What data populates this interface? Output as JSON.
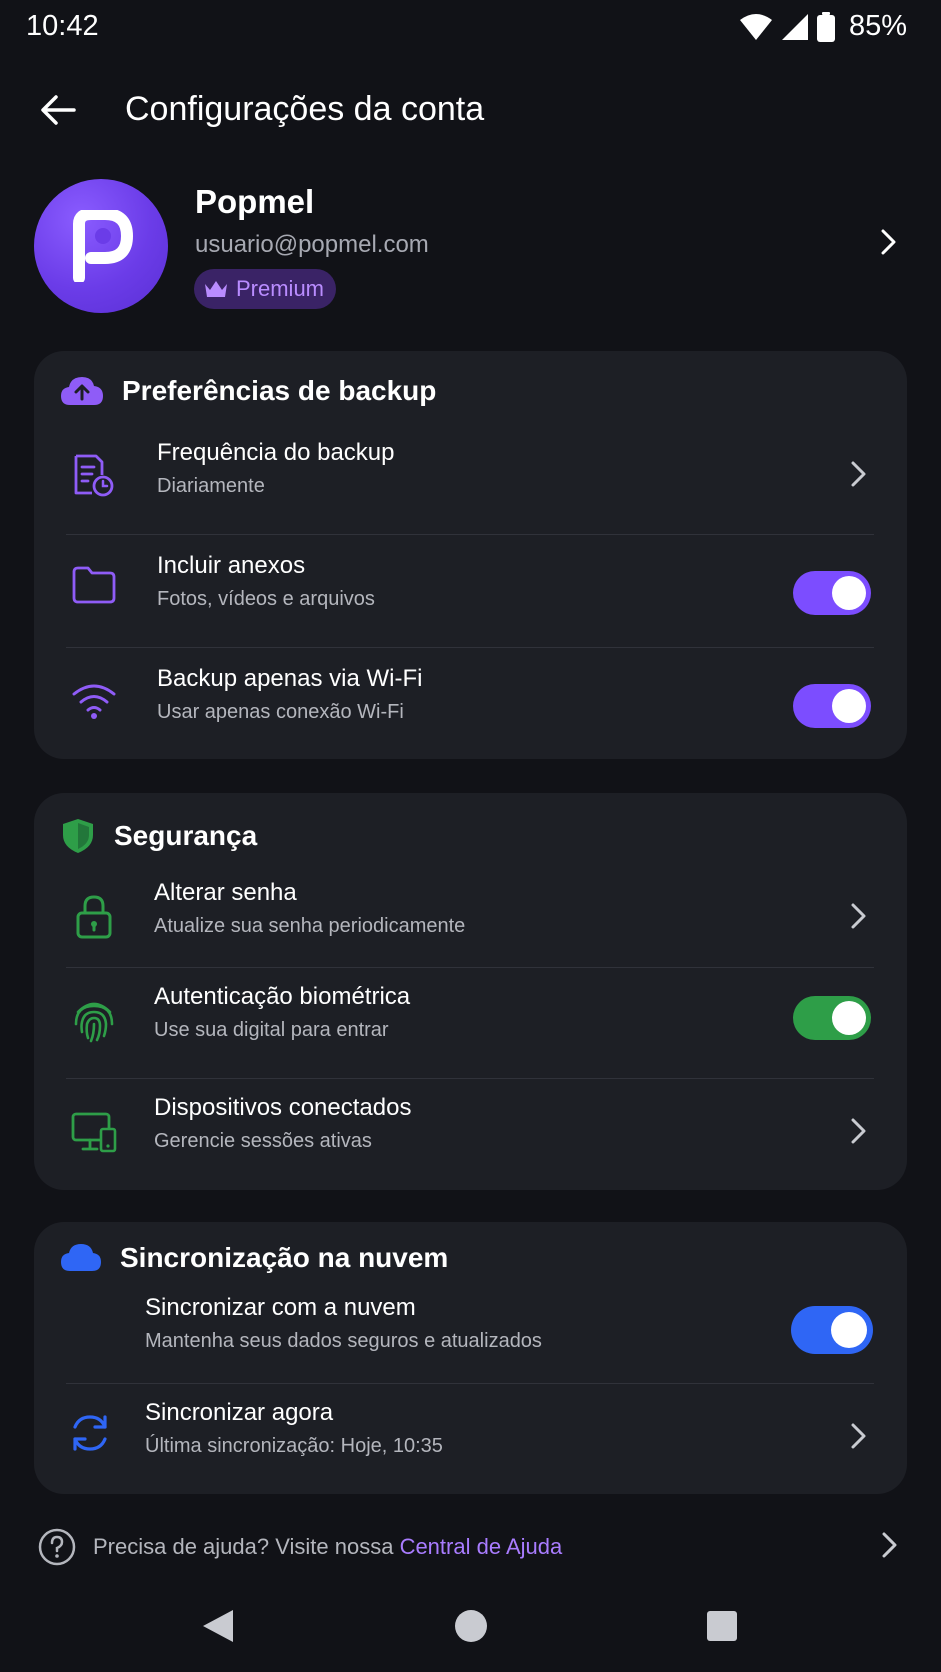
{
  "status_bar": {
    "time": "10:42",
    "battery": "85%"
  },
  "app_bar": {
    "title": "Configurações da conta"
  },
  "profile": {
    "name": "Popmel",
    "email": "usuario@popmel.com",
    "badge": "Premium"
  },
  "backup": {
    "header": "Preferências de backup",
    "rows": [
      {
        "title": "Frequência do backup",
        "subtitle": "Diariamente",
        "control": "chevron"
      },
      {
        "title": "Incluir anexos",
        "subtitle": "Fotos, vídeos e arquivos",
        "control": "toggle",
        "on": true
      },
      {
        "title": "Backup apenas via Wi-Fi",
        "subtitle": "Usar apenas conexão Wi-Fi",
        "control": "toggle",
        "on": true
      }
    ]
  },
  "security": {
    "header": "Segurança",
    "rows": [
      {
        "title": "Alterar senha",
        "subtitle": "Atualize sua senha periodicamente",
        "control": "chevron"
      },
      {
        "title": "Autenticação biométrica",
        "subtitle": "Use sua digital para entrar",
        "control": "toggle",
        "on": true
      },
      {
        "title": "Dispositivos conectados",
        "subtitle": "Gerencie sessões ativas",
        "control": "chevron"
      }
    ]
  },
  "sync": {
    "header": "Sincronização na nuvem",
    "rows": [
      {
        "title": "Sincronizar com a nuvem",
        "subtitle": "Mantenha seus dados seguros e atualizados",
        "control": "toggle",
        "on": true
      },
      {
        "title": "Sincronizar agora",
        "subtitle": "Última sincronização: Hoje, 10:35",
        "control": "chevron"
      }
    ]
  },
  "help": {
    "text": "Precisa de ajuda? Visite nossa ",
    "link": "Central de Ajuda"
  },
  "colors": {
    "background": "#111217",
    "card": "#1d1f25",
    "purple_accent": "#7c4dff",
    "green_accent": "#2e9e48",
    "blue_accent": "#2f66f5",
    "link": "#a97cff"
  },
  "icons": {
    "back": "arrow-left-icon",
    "backup_header": "cloud-upload-icon",
    "backup_frequency": "calendar-clock-icon",
    "attachments": "folder-icon",
    "wifi": "wifi-icon",
    "security_header": "shield-check-icon",
    "password": "lock-icon",
    "biometric": "fingerprint-icon",
    "devices": "monitor-devices-icon",
    "sync_header": "cloud-icon",
    "sync_now": "refresh-icon",
    "help": "help-circle-icon"
  }
}
